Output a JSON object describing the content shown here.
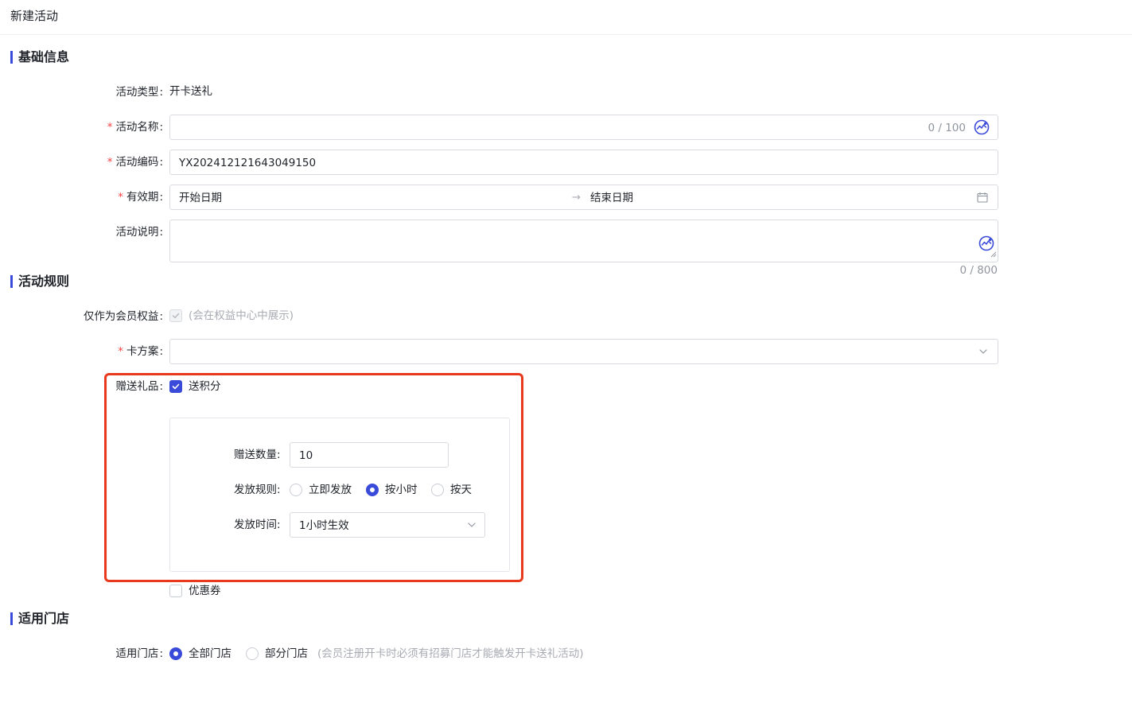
{
  "page": {
    "title": "新建活动"
  },
  "sections": {
    "basic": "基础信息",
    "rules": "活动规则",
    "stores": "适用门店"
  },
  "fields": {
    "type": {
      "label": "活动类型",
      "value": "开卡送礼"
    },
    "name": {
      "label": "活动名称",
      "value": "",
      "counter": "0 / 100"
    },
    "code": {
      "label": "活动编码",
      "value": "YX202412121643049150"
    },
    "period": {
      "label": "有效期",
      "start_placeholder": "开始日期",
      "end_placeholder": "结束日期",
      "separator": "→"
    },
    "desc": {
      "label": "活动说明",
      "value": "",
      "counter": "0 / 800"
    },
    "member_only": {
      "label": "仅作为会员权益",
      "hint": "(会在权益中心中展示)",
      "checked": true,
      "disabled": true
    },
    "card_plan": {
      "label": "卡方案",
      "value": ""
    },
    "gift": {
      "label": "赠送礼品",
      "points": {
        "label": "送积分",
        "checked": true
      },
      "quantity": {
        "label": "赠送数量",
        "value": "10"
      },
      "rule": {
        "label": "发放规则",
        "options": [
          "立即发放",
          "按小时",
          "按天"
        ],
        "selected": "按小时"
      },
      "time": {
        "label": "发放时间",
        "value": "1小时生效"
      },
      "coupon": {
        "label": "优惠券",
        "checked": false
      }
    },
    "store": {
      "label": "适用门店",
      "options": [
        "全部门店",
        "部分门店"
      ],
      "selected": "全部门店",
      "hint": "(会员注册开卡时必须有招募门店才能触发开卡送礼活动)"
    }
  },
  "colors": {
    "accent": "#3a4ad9",
    "required": "#f53f3f",
    "highlight": "#e8391d"
  },
  "icons": [
    "ai-assist-icon",
    "calendar-icon",
    "chevron-down-icon",
    "check-icon",
    "arrow-right-icon"
  ]
}
